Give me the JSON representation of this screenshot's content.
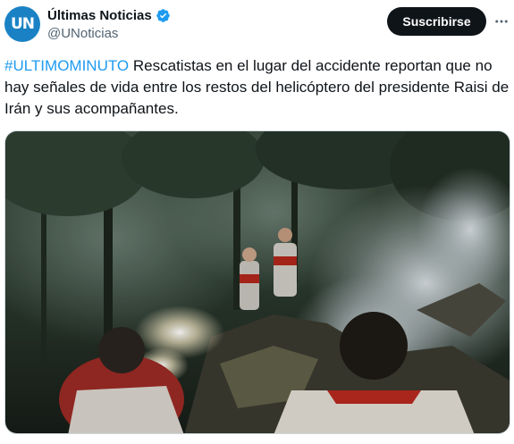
{
  "account": {
    "avatar_text": "UN",
    "display_name": "Últimas Noticias",
    "handle": "@UNoticias",
    "verified": true
  },
  "actions": {
    "subscribe_label": "Suscribirse",
    "more_icon": "more-horizontal-icon"
  },
  "tweet": {
    "hashtag": "#ULTIMOMINUTO",
    "body": " Rescatistas en el lugar del accidente reportan que no hay señales de vida entre los restos del helicóptero del presidente Raisi de Irán y sus acompañantes."
  },
  "colors": {
    "accent": "#1d9bf0",
    "avatar_bg": "#1a82c4",
    "button_bg": "#0f1419",
    "text_primary": "#0f1419",
    "text_secondary": "#536471"
  }
}
